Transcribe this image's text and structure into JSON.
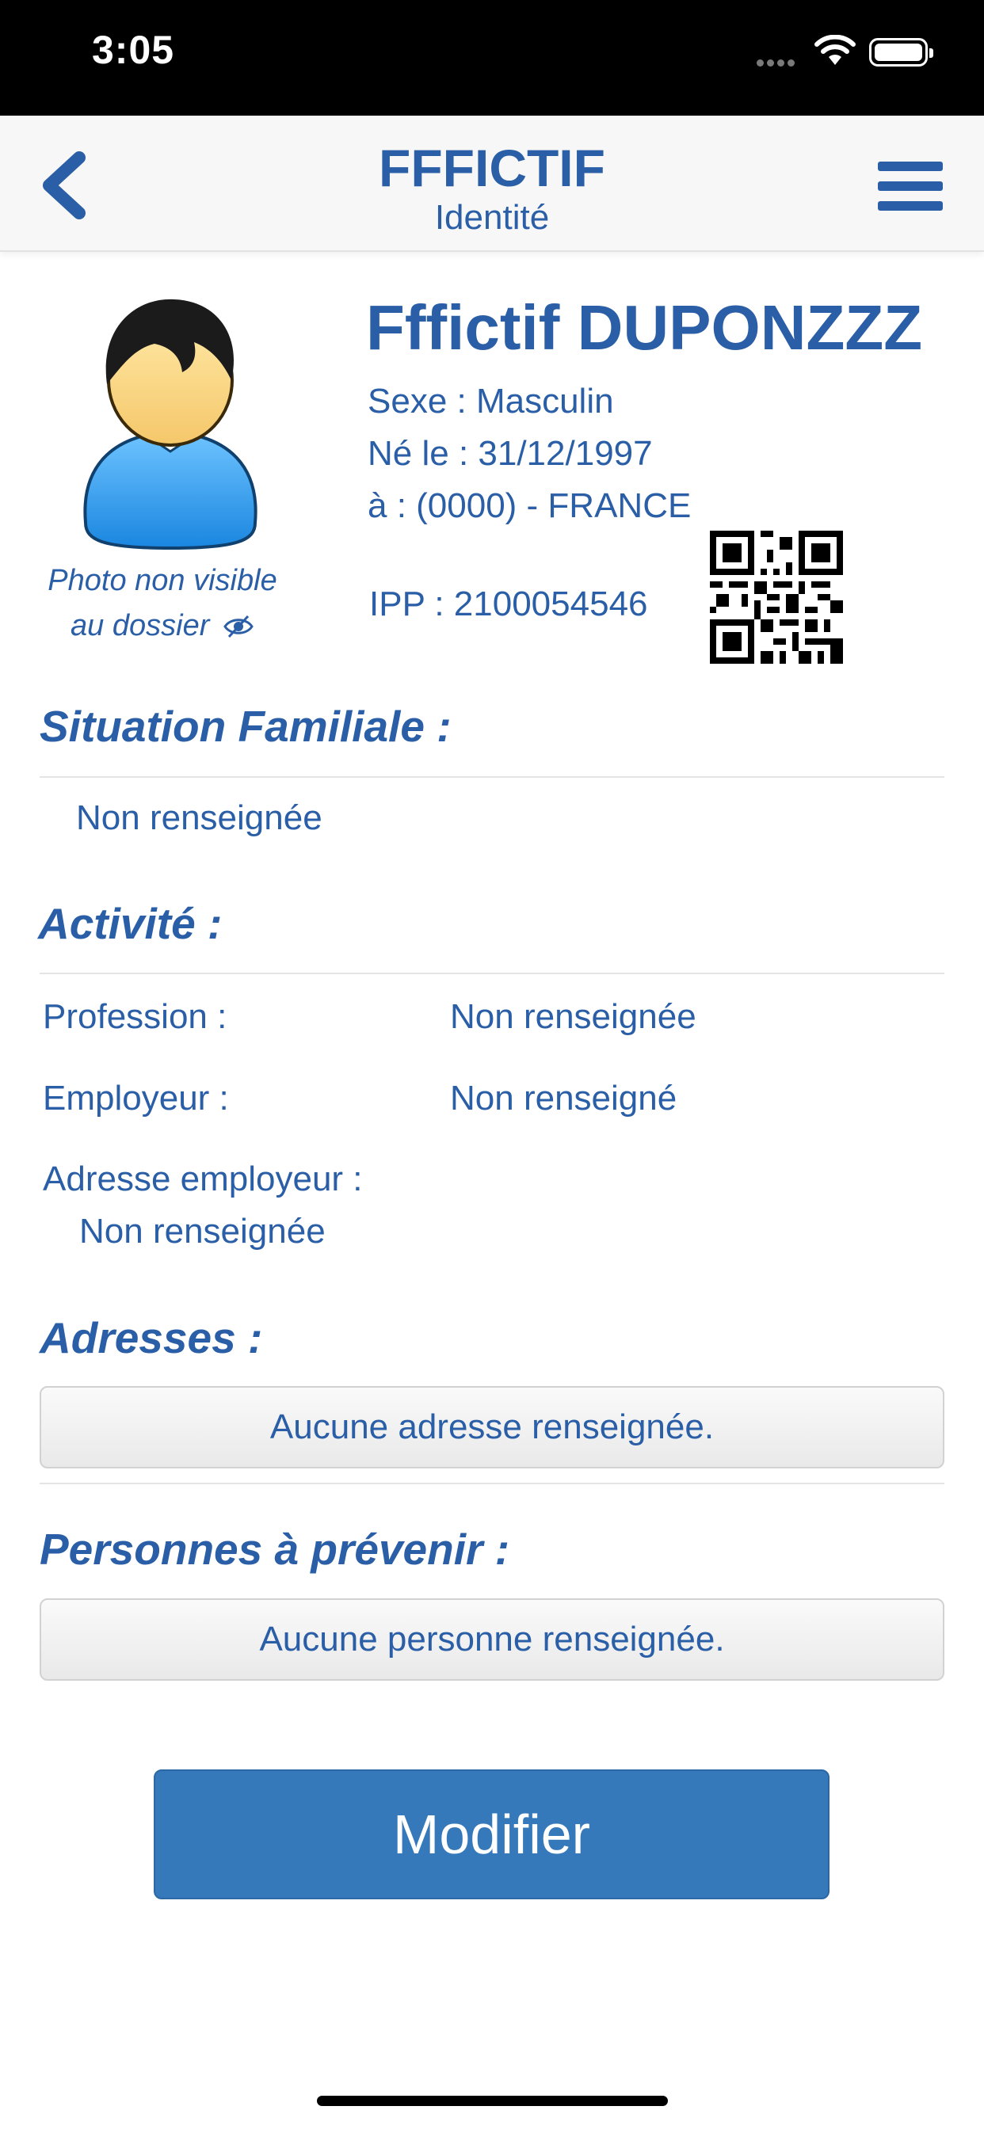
{
  "status_bar": {
    "time": "3:05"
  },
  "nav": {
    "title": "FFFICTIF",
    "subtitle": "Identité"
  },
  "patient": {
    "name": "Fffictif DUPONZZZ",
    "sexe": "Sexe : Masculin",
    "naissance": "Né le : 31/12/1997",
    "lieu": "à : (0000) - FRANCE",
    "ipp": "IPP : 2100054546",
    "photo_note_line1": "Photo non visible",
    "photo_note_line2": "au dossier"
  },
  "situation": {
    "title": "Situation Familiale :",
    "value": "Non renseignée"
  },
  "activite": {
    "title": "Activité :",
    "profession_label": "Profession :",
    "profession_value": "Non renseignée",
    "employeur_label": "Employeur :",
    "employeur_value": "Non renseigné",
    "adresse_employeur_label": "Adresse employeur :",
    "adresse_employeur_value": "Non renseignée"
  },
  "adresses": {
    "title": "Adresses :",
    "empty_text": "Aucune adresse renseignée."
  },
  "personnes": {
    "title": "Personnes à prévenir :",
    "empty_text": "Aucune personne renseignée."
  },
  "actions": {
    "modifier_label": "Modifier"
  },
  "colors": {
    "accent": "#2a5ea6",
    "button": "#3579bb",
    "status_bar": "#000000"
  },
  "icons": [
    "back-chevron-icon",
    "hamburger-menu-icon",
    "eye-slash-icon",
    "qr-code-icon",
    "wifi-icon",
    "battery-icon",
    "signal-icon"
  ]
}
